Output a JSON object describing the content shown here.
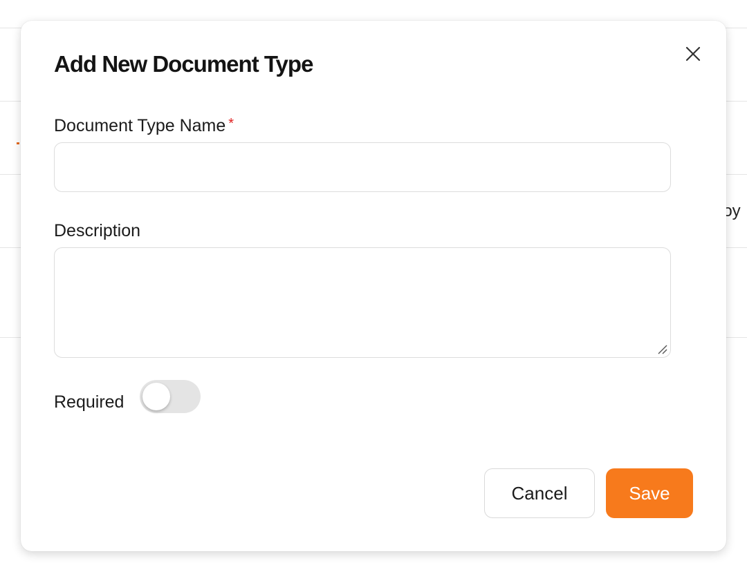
{
  "background": {
    "partial_text": "loy"
  },
  "dialog": {
    "title": "Add New Document Type",
    "close_icon": "close-icon",
    "fields": {
      "name": {
        "label": "Document Type Name",
        "required_marker": "*",
        "value": "",
        "placeholder": ""
      },
      "description": {
        "label": "Description",
        "value": "",
        "placeholder": ""
      },
      "required": {
        "label": "Required",
        "checked": false
      }
    },
    "buttons": {
      "cancel": "Cancel",
      "save": "Save"
    }
  },
  "colors": {
    "accent": "#f77a1c",
    "required_star": "#e02020",
    "toggle_off": "#e4e4e4",
    "border": "#dcdcdc"
  }
}
